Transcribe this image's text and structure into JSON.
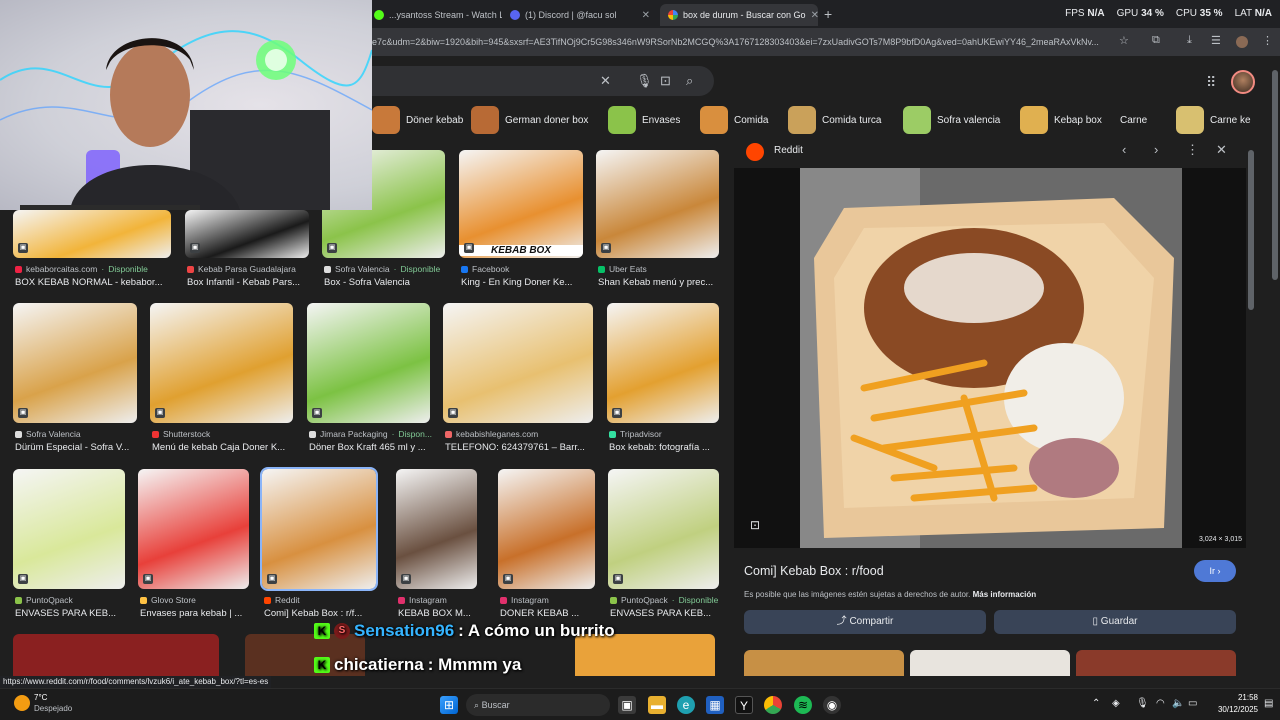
{
  "browser": {
    "tabs": [
      {
        "label": "...ysantoss Stream - Watch Liv",
        "color": "#53fc18"
      },
      {
        "label": "(1) Discord | @facu sol",
        "color": "#5865f2"
      },
      {
        "label": "box de durum - Buscar con Go",
        "color": "#4285f4"
      }
    ],
    "new_tab": "+",
    "close": "✕",
    "url": "e7c&udm=2&biw=1920&bih=945&sxsrf=AE3TifNOj9Cr5G98s346nW9RSorNb2MCGQ%3A1767128303403&ei=7zxUadivGOTs7M8P9bfD0Ag&ved=0ahUKEwiYY46_2meaRAxVkNv..."
  },
  "perf": {
    "fps_label": "FPS",
    "fps_value": "N/A",
    "gpu_label": "GPU",
    "gpu_value": "34 %",
    "cpu_label": "CPU",
    "cpu_value": "35 %",
    "lat_label": "LAT",
    "lat_value": "N/A"
  },
  "chips": [
    {
      "label": "Döner kebab",
      "color": "#c8793a"
    },
    {
      "label": "German doner box",
      "color": "#b86a35"
    },
    {
      "label": "Envases",
      "color": "#8bc34a"
    },
    {
      "label": "Comida",
      "color": "#d98f3e"
    },
    {
      "label": "Comida turca",
      "color": "#caa15a"
    },
    {
      "label": "Sofra valencia",
      "color": "#9ccc65"
    },
    {
      "label": "Kebap box",
      "color": "#e0b050"
    },
    {
      "label": "Carne",
      "color": ""
    },
    {
      "label": "Carne ke",
      "color": "#d8c070"
    }
  ],
  "results": [
    {
      "source": "kebaborcaitas.com",
      "avail": "Disponible",
      "title": "BOX KEBAB NORMAL - kebabor...",
      "color": "#f2b43a",
      "srcColor": "#e24"
    },
    {
      "source": "Kebab Parsa Guadalajara",
      "avail": "",
      "title": "Box Infantil - Kebab Pars...",
      "color": "#1a1a1a",
      "srcColor": "#e44"
    },
    {
      "source": "Sofra Valencia",
      "avail": "Disponible",
      "title": "Box - Sofra Valencia",
      "color": "#8bc34a",
      "srcColor": "#ddd"
    },
    {
      "source": "Facebook",
      "avail": "",
      "title": "King - En King Doner Ke...",
      "color": "#e89030",
      "srcColor": "#1877f2",
      "caption": "KEBAB BOX"
    },
    {
      "source": "Uber Eats",
      "avail": "",
      "title": "Shan Kebab menú y prec...",
      "color": "#c9873a",
      "srcColor": "#06c167"
    },
    {
      "source": "Sofra Valencia",
      "avail": "",
      "title": "Dürüm Especial - Sofra V...",
      "color": "#d9a24a",
      "srcColor": "#ddd"
    },
    {
      "source": "Shutterstock",
      "avail": "",
      "title": "Menú de kebab Caja Doner K...",
      "color": "#e0a030",
      "srcColor": "#e33"
    },
    {
      "source": "Jimara Packaging",
      "avail": "Dispon...",
      "title": "Döner Box Kraft 465 ml y ...",
      "color": "#7cc243",
      "srcColor": "#ddd"
    },
    {
      "source": "kebabishleganes.com",
      "avail": "",
      "title": "TELEFONO: 624379761 – Barr...",
      "color": "#e8c070",
      "srcColor": "#e66"
    },
    {
      "source": "Tripadvisor",
      "avail": "",
      "title": "Box kebab: fotografía ...",
      "color": "#e3a030",
      "srcColor": "#34e0a1"
    },
    {
      "source": "PuntoQpack",
      "avail": "",
      "title": "ENVASES PARA KEB...",
      "color": "#d9e89a",
      "srcColor": "#8bc34a"
    },
    {
      "source": "Glovo Store",
      "avail": "",
      "title": "Envases para kebab | ...",
      "color": "#e8403a",
      "srcColor": "#ffc244"
    },
    {
      "source": "Reddit",
      "avail": "",
      "title": "Comi] Kebab Box : r/f...",
      "color": "#d89040",
      "srcColor": "#ff4500"
    },
    {
      "source": "Instagram",
      "avail": "",
      "title": "KEBAB BOX M...",
      "color": "#6a5040",
      "srcColor": "#e1306c"
    },
    {
      "source": "Instagram",
      "avail": "",
      "title": "DONER KEBAB ...",
      "color": "#c8702a",
      "srcColor": "#e1306c"
    },
    {
      "source": "PuntoQpack",
      "avail": "Disponible",
      "title": "ENVASES PARA KEB...",
      "color": "#c0d080",
      "srcColor": "#8bc34a"
    }
  ],
  "panel": {
    "source": "Reddit",
    "dims": "3,024 × 3,015",
    "title": "Comi] Kebab Box : r/food",
    "go_label": "Ir",
    "copyright": "Es posible que las imágenes estén sujetas a derechos de autor.",
    "more_info": "Más información",
    "share_label": "Compartir",
    "save_label": "Guardar"
  },
  "chat": [
    {
      "user": "Sensation96",
      "message": ": A cómo un burrito",
      "user_color": "#35b4ff"
    },
    {
      "user": "chicatierna",
      "message": ": Mmmm ya",
      "user_color": "#ffffff"
    }
  ],
  "status_url": "https://www.reddit.com/r/food/comments/lvzuk6/i_ate_kebab_box/?tl=es-es",
  "taskbar": {
    "weather_temp": "7°C",
    "weather_desc": "Despejado",
    "search_placeholder": "Buscar",
    "time": "21:58",
    "date": "30/12/2025"
  }
}
